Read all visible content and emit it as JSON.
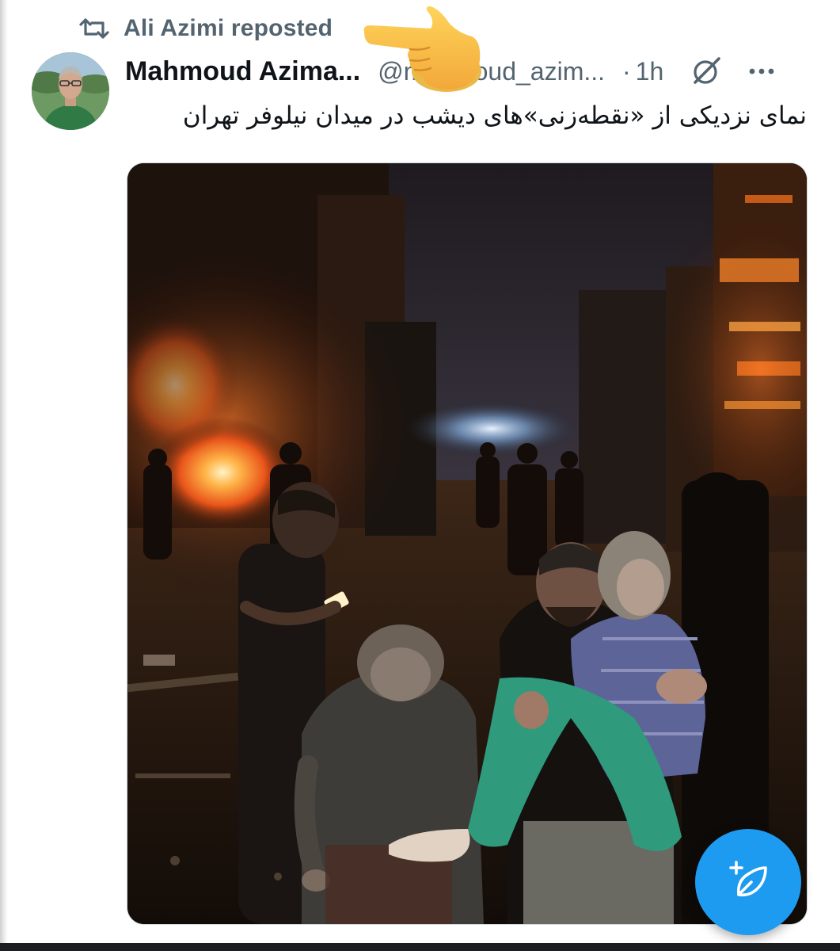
{
  "repost": {
    "label": "Ali Azimi reposted",
    "icon": "repost-icon"
  },
  "tweet": {
    "display_name": "Mahmoud Azima...",
    "handle": "@mahmoud_azim...",
    "separator": "·",
    "time": "1h",
    "text": "نمای نزدیکی از «نقطه‌زنی»‌های دیشب در میدان نیلوفر تهران"
  },
  "icons": {
    "grok": "grok-icon",
    "more": "more-options-icon",
    "compose": "compose-post-icon",
    "pointer": "pointing-hand-emoji"
  },
  "colors": {
    "text_primary": "#0f1419",
    "text_secondary": "#536471",
    "accent": "#1d9bf0"
  }
}
